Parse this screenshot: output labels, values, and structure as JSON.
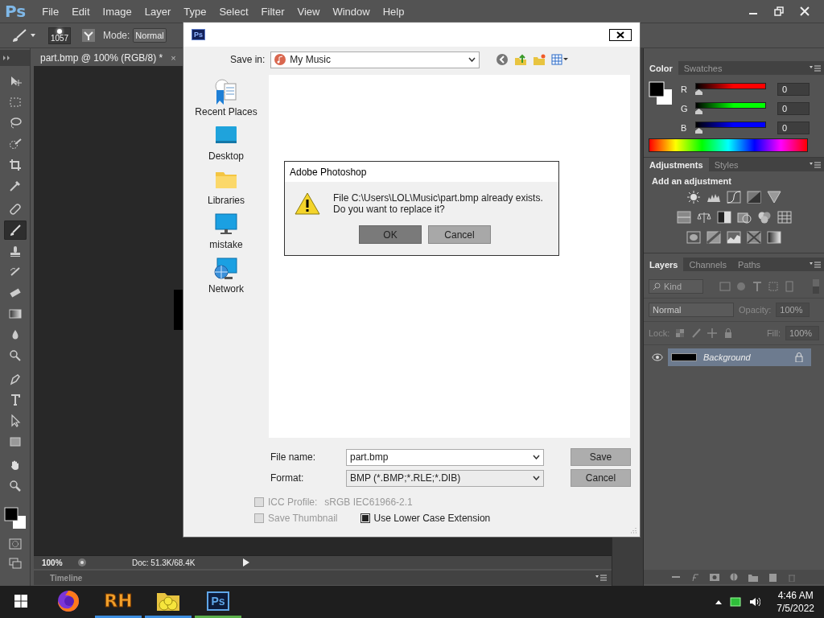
{
  "app": {
    "logo": "Ps"
  },
  "menu_bar": {
    "items": [
      "File",
      "Edit",
      "Image",
      "Layer",
      "Type",
      "Select",
      "Filter",
      "View",
      "Window",
      "Help"
    ]
  },
  "options_bar": {
    "brush_size": "1057",
    "mode_label": "Mode:",
    "mode_value": "Normal"
  },
  "document_tab": {
    "title": "part.bmp @ 100% (RGB/8) *",
    "close": "×"
  },
  "tools": [
    {
      "kind": "move",
      "selected": false
    },
    {
      "kind": "marquee",
      "selected": false
    },
    {
      "kind": "lasso",
      "selected": false
    },
    {
      "kind": "quick-select",
      "selected": false
    },
    {
      "kind": "crop",
      "selected": false
    },
    {
      "kind": "eyedropper",
      "selected": false
    },
    {
      "kind": "healing",
      "selected": false
    },
    {
      "kind": "brush",
      "selected": true
    },
    {
      "kind": "stamp",
      "selected": false
    },
    {
      "kind": "history-brush",
      "selected": false
    },
    {
      "kind": "eraser",
      "selected": false
    },
    {
      "kind": "gradient",
      "selected": false
    },
    {
      "kind": "blur",
      "selected": false
    },
    {
      "kind": "dodge",
      "selected": false
    },
    {
      "kind": "pen",
      "selected": false
    },
    {
      "kind": "type",
      "selected": false
    },
    {
      "kind": "path-select",
      "selected": false
    },
    {
      "kind": "shape",
      "selected": false
    },
    {
      "kind": "hand",
      "selected": false
    },
    {
      "kind": "zoom",
      "selected": false
    }
  ],
  "status_bar": {
    "zoom": "100%",
    "doc": "Doc: 51.3K/68.4K"
  },
  "timeline": {
    "title": "Timeline"
  },
  "color_panel": {
    "tabs": [
      {
        "label": "Color",
        "selected": true
      },
      {
        "label": "Swatches",
        "selected": false
      }
    ],
    "channels": [
      {
        "name": "R",
        "color": "#ff0000",
        "level": 0,
        "value": "0"
      },
      {
        "name": "G",
        "color": "#00ff00",
        "level": 0,
        "value": "0"
      },
      {
        "name": "B",
        "color": "#0000ff",
        "level": 0,
        "value": "0"
      }
    ]
  },
  "adjustments_panel": {
    "tabs": [
      {
        "label": "Adjustments",
        "selected": true
      },
      {
        "label": "Styles",
        "selected": false
      }
    ],
    "heading": "Add an adjustment"
  },
  "layers_panel": {
    "tabs": [
      {
        "label": "Layers",
        "selected": true
      },
      {
        "label": "Channels",
        "selected": false
      },
      {
        "label": "Paths",
        "selected": false
      }
    ],
    "filter": "Kind",
    "blend_mode": "Normal",
    "opacity_label": "Opacity:",
    "opacity": "100%",
    "lock_label": "Lock:",
    "fill_label": "Fill:",
    "fill": "100%",
    "layers": [
      {
        "name": "Background",
        "visible": true,
        "selected": true,
        "locked": true
      }
    ]
  },
  "save_dialog": {
    "logo": "Ps",
    "save_in_label": "Save in:",
    "save_in": "My Music",
    "places": [
      {
        "kind": "recent",
        "label": "Recent Places"
      },
      {
        "kind": "desktop",
        "label": "Desktop"
      },
      {
        "kind": "libraries",
        "label": "Libraries"
      },
      {
        "kind": "computer",
        "label": "mistake"
      },
      {
        "kind": "network",
        "label": "Network"
      }
    ],
    "file_name_label": "File name:",
    "file_name": "part.bmp",
    "format_label": "Format:",
    "format": "BMP (*.BMP;*.RLE;*.DIB)",
    "buttons": [
      "Save",
      "Cancel"
    ],
    "options": [
      {
        "label": "ICC Profile:",
        "value": "sRGB IEC61966-2.1",
        "checked": false,
        "disabled": true
      },
      {
        "label": "Save Thumbnail",
        "checked": false,
        "disabled": true
      },
      {
        "label": "Use Lower Case Extension",
        "checked": true,
        "disabled": false
      }
    ]
  },
  "alert": {
    "title": "Adobe Photoshop",
    "message_lines": [
      "File C:\\Users\\LOL\\Music\\part.bmp already exists.",
      "Do you want to replace it?"
    ],
    "buttons": [
      {
        "label": "OK",
        "selected": true
      },
      {
        "label": "Cancel",
        "selected": false
      }
    ]
  },
  "taskbar": {
    "apps": [
      {
        "kind": "firefox",
        "running": false
      },
      {
        "kind": "text-logo",
        "label": "RH",
        "running": true,
        "color": "#3d8ee0"
      },
      {
        "kind": "folder",
        "running": true,
        "color": "#3d8ee0"
      },
      {
        "kind": "text-logo-boxed",
        "label": "Ps",
        "running": true,
        "color": "#5bb04a"
      }
    ],
    "time": "4:46 AM",
    "date": "7/5/2022"
  }
}
